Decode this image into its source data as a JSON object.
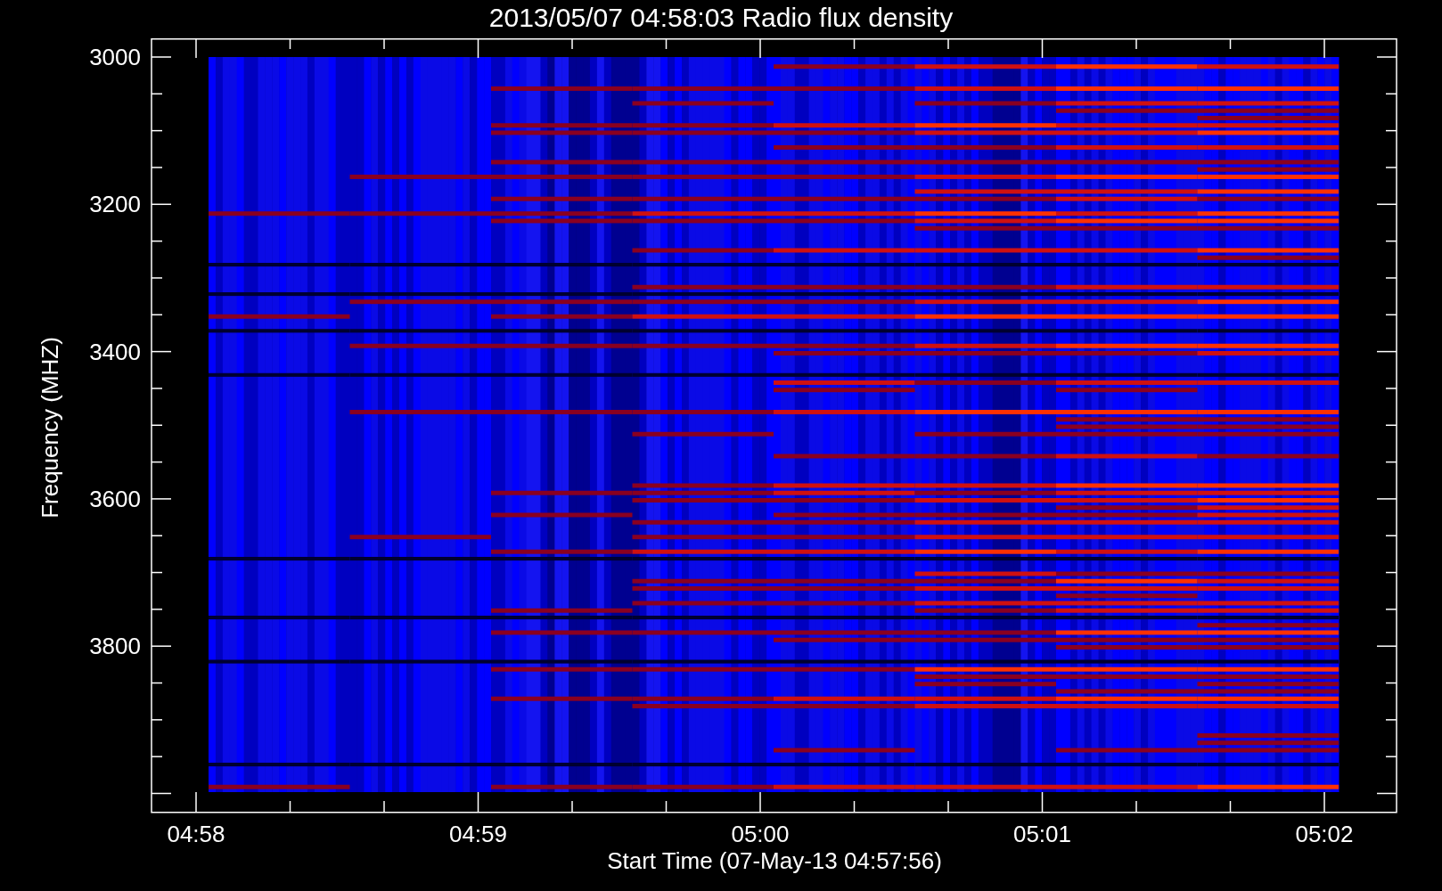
{
  "title": "2013/05/07 04:58:03 Radio flux density",
  "plot": {
    "ylabel": "Frequency (MHZ)",
    "xlabel": "Start Time (07-May-13 04:57:56)",
    "yticks": [
      "3000",
      "3200",
      "3400",
      "3600",
      "3800"
    ],
    "xticks": [
      "04:58",
      "04:59",
      "05:00",
      "05:01",
      "05:02"
    ]
  }
}
